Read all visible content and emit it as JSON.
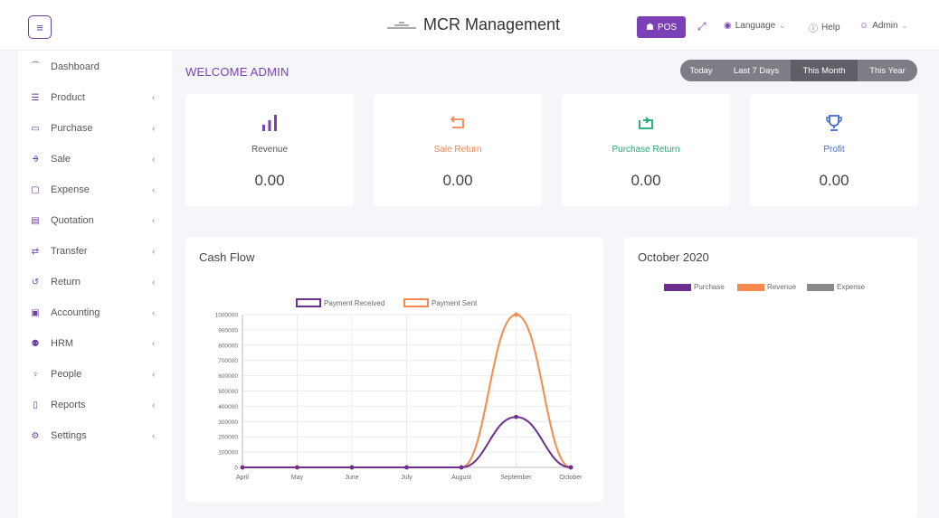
{
  "header": {
    "brand": "MCR Management",
    "pos_label": "POS",
    "language_label": "Language",
    "help_label": "Help",
    "admin_label": "Admin"
  },
  "sidebar": {
    "items": [
      {
        "label": "Dashboard",
        "icon": "dashboard-icon",
        "glyph": "⁀",
        "chevron": ""
      },
      {
        "label": "Product",
        "icon": "list-icon",
        "glyph": "☰",
        "chevron": "‹"
      },
      {
        "label": "Purchase",
        "icon": "card-icon",
        "glyph": "▭",
        "chevron": "‹"
      },
      {
        "label": "Sale",
        "icon": "cart-icon",
        "glyph": "⨮",
        "chevron": "‹"
      },
      {
        "label": "Expense",
        "icon": "wallet-icon",
        "glyph": "▢",
        "chevron": "‹"
      },
      {
        "label": "Quotation",
        "icon": "document-icon",
        "glyph": "▤",
        "chevron": "‹"
      },
      {
        "label": "Transfer",
        "icon": "transfer-icon",
        "glyph": "⇄",
        "chevron": "‹"
      },
      {
        "label": "Return",
        "icon": "return-icon",
        "glyph": "↺",
        "chevron": "‹"
      },
      {
        "label": "Accounting",
        "icon": "briefcase-icon",
        "glyph": "▣",
        "chevron": "‹"
      },
      {
        "label": "HRM",
        "icon": "users-icon",
        "glyph": "⚉",
        "chevron": "‹"
      },
      {
        "label": "People",
        "icon": "person-icon",
        "glyph": "♀",
        "chevron": "‹"
      },
      {
        "label": "Reports",
        "icon": "report-icon",
        "glyph": "▯",
        "chevron": "‹"
      },
      {
        "label": "Settings",
        "icon": "gear-icon",
        "glyph": "⚙",
        "chevron": "‹"
      }
    ]
  },
  "main": {
    "welcome": "WELCOME ADMIN",
    "filters": [
      {
        "label": "Today",
        "active": false
      },
      {
        "label": "Last 7 Days",
        "active": false
      },
      {
        "label": "This Month",
        "active": true
      },
      {
        "label": "This Year",
        "active": false
      }
    ],
    "cards": [
      {
        "label": "Revenue",
        "value": "0.00",
        "icon": "bar-chart-icon",
        "color": "#7b3fb6"
      },
      {
        "label": "Sale Return",
        "value": "0.00",
        "icon": "return-arrow-icon",
        "color": "#f08556"
      },
      {
        "label": "Purchase Return",
        "value": "0.00",
        "icon": "refresh-icon",
        "color": "#1aab6c"
      },
      {
        "label": "Profit",
        "value": "0.00",
        "icon": "trophy-icon",
        "color": "#3e6bd8"
      }
    ]
  },
  "cashflow": {
    "title": "Cash Flow",
    "legend": [
      {
        "label": "Payment Received",
        "color": "#6c2f8f"
      },
      {
        "label": "Payment Sent",
        "color": "#f58a4c"
      }
    ]
  },
  "monthly": {
    "title": "October 2020",
    "legend": [
      {
        "label": "Purchase",
        "color": "#6c2f8f"
      },
      {
        "label": "Revenue",
        "color": "#f58a4c"
      },
      {
        "label": "Expense",
        "color": "#8a8a8a"
      }
    ]
  },
  "chart_data": {
    "type": "line",
    "x": [
      "April",
      "May",
      "June",
      "July",
      "August",
      "September",
      "October"
    ],
    "series": [
      {
        "name": "Payment Received",
        "values": [
          0,
          0,
          0,
          0,
          0,
          330000,
          0
        ]
      },
      {
        "name": "Payment Sent",
        "values": [
          0,
          0,
          0,
          0,
          0,
          1000000,
          0
        ]
      }
    ],
    "yticks": [
      "0",
      "100000",
      "200000",
      "300000",
      "400000",
      "500000",
      "600000",
      "700000",
      "800000",
      "900000",
      "1000000"
    ],
    "ylim": [
      0,
      1000000
    ],
    "grid": true,
    "legend_position": "top"
  }
}
